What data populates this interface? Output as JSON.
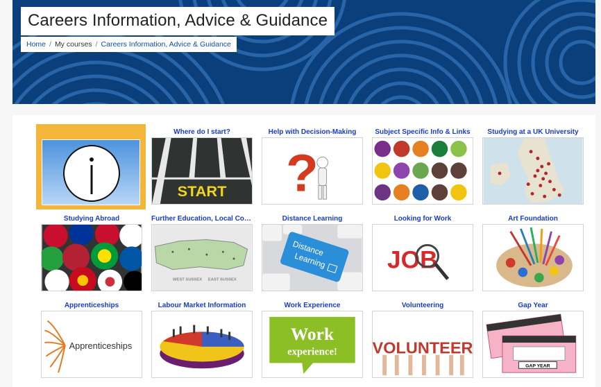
{
  "header": {
    "title": "Careers Information, Advice & Guidance",
    "breadcrumb": [
      "Home",
      "My courses",
      "Careers Information, Advice & Guidance"
    ]
  },
  "colors": {
    "banner": "#0b3f7c",
    "link": "#1a3cc8",
    "highlight": "#f4b63a"
  },
  "tiles": [
    {
      "label": "Where do I start?",
      "icon": "start-road-image"
    },
    {
      "label": "Help with Decision-Making",
      "icon": "question-mark-image"
    },
    {
      "label": "Subject Specific Info & Links",
      "icon": "subject-icons-image"
    },
    {
      "label": "Studying at a UK University",
      "icon": "uk-map-image"
    },
    {
      "label": "Studying Abroad",
      "icon": "flags-image"
    },
    {
      "label": "Further Education, Local Colleg...",
      "icon": "sussex-map-image"
    },
    {
      "label": "Distance Learning",
      "icon": "keyboard-image"
    },
    {
      "label": "Looking for Work",
      "icon": "job-magnifier-image"
    },
    {
      "label": "Art Foundation",
      "icon": "paint-palette-image"
    },
    {
      "label": "Apprenticeships",
      "icon": "apprenticeships-logo-image"
    },
    {
      "label": "Labour Market Information",
      "icon": "pie-chart-image"
    },
    {
      "label": "Work Experience",
      "icon": "work-experience-image"
    },
    {
      "label": "Volunteering",
      "icon": "volunteer-image"
    },
    {
      "label": "Gap Year",
      "icon": "gap-year-ticket-image"
    }
  ],
  "images": {
    "start_text": "START",
    "sussex_west": "WEST SUSSEX",
    "sussex_east": "EAST SUSSEX",
    "distance_text_1": "Distance",
    "distance_text_2": "Learning",
    "job_text": "JOB",
    "apprenticeships_text": "Apprenticeships",
    "work_text_1": "Work",
    "work_text_2": "experience!",
    "volunteer_text": "VOLUNTEER",
    "gap_year_text": "GAP YEAR"
  }
}
